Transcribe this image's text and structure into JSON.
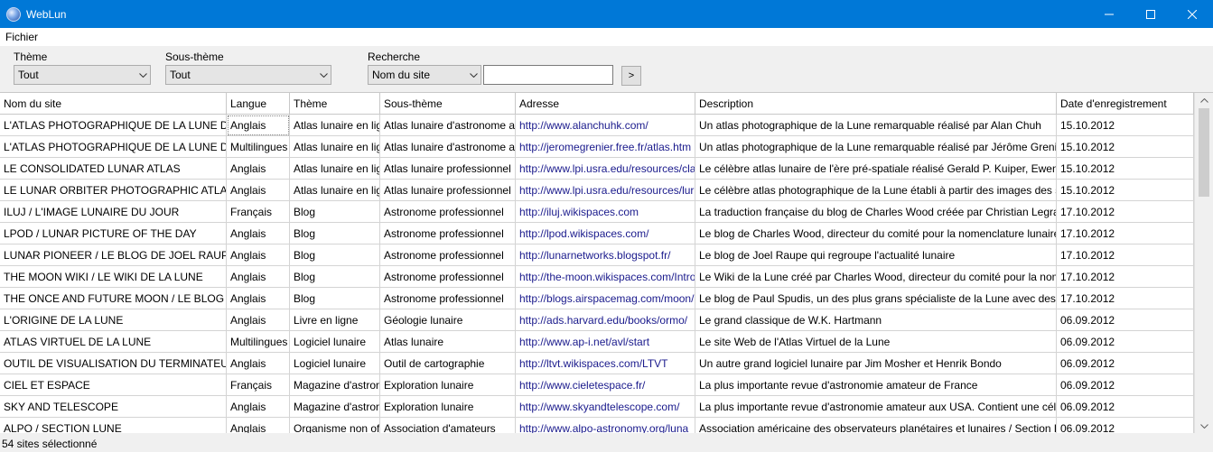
{
  "window": {
    "title": "WebLun"
  },
  "menu": {
    "file": "Fichier"
  },
  "filters": {
    "theme_label": "Thème",
    "theme_value": "Tout",
    "subtheme_label": "Sous-thème",
    "subtheme_value": "Tout",
    "search_label": "Recherche",
    "search_field_value": "Nom du site",
    "search_text": "",
    "go_label": ">"
  },
  "table": {
    "columns": [
      "Nom du site",
      "Langue",
      "Thème",
      "Sous-thème",
      "Adresse",
      "Description",
      "Date d'enregistrement"
    ],
    "rows": [
      [
        "L'ATLAS PHOTOGRAPHIQUE DE LA LUNE DE AL",
        "Anglais",
        "Atlas lunaire en lig",
        "Atlas lunaire d'astronome a",
        "http://www.alanchuhk.com/",
        "Un atlas photographique de la Lune remarquable réalisé par Alan Chuh",
        "15.10.2012"
      ],
      [
        "L'ATLAS PHOTOGRAPHIQUE DE LA LUNE DE JE",
        "Multilingues",
        "Atlas lunaire en lig",
        "Atlas lunaire d'astronome a",
        "http://jeromegrenier.free.fr/atlas.htm",
        "Un atlas photographique de la Lune remarquable réalisé par Jérôme Grenier",
        "15.10.2012"
      ],
      [
        "LE CONSOLIDATED LUNAR ATLAS",
        "Anglais",
        "Atlas lunaire en lig",
        "Atlas lunaire professionnel",
        "http://www.lpi.usra.edu/resources/cla",
        "Le célèbre atlas lunaire de l'ère pré-spatiale réalisé Gerald P. Kuiper, Ewen A",
        "15.10.2012"
      ],
      [
        "LE LUNAR ORBITER PHOTOGRAPHIC ATLAS OF",
        "Anglais",
        "Atlas lunaire en lig",
        "Atlas lunaire professionnel",
        "http://www.lpi.usra.edu/resources/lur",
        "Le célèbre atlas photographique de la Lune établi à partir des images des sc",
        "15.10.2012"
      ],
      [
        "ILUJ / L'IMAGE LUNAIRE DU JOUR",
        "Français",
        "Blog",
        "Astronome professionnel",
        "http://iluj.wikispaces.com",
        "La traduction française du blog de Charles Wood créée par Christian Legran",
        "17.10.2012"
      ],
      [
        "LPOD / LUNAR PICTURE OF THE DAY",
        "Anglais",
        "Blog",
        "Astronome professionnel",
        "http://lpod.wikispaces.com/",
        "Le blog de Charles Wood, directeur du comité pour la nomenclature lunaire",
        "17.10.2012"
      ],
      [
        "LUNAR PIONEER / LE BLOG DE JOEL RAUPE",
        "Anglais",
        "Blog",
        "Astronome professionnel",
        "http://lunarnetworks.blogspot.fr/",
        "Le blog de Joel Raupe qui regroupe l'actualité lunaire",
        "17.10.2012"
      ],
      [
        "THE MOON WIKI / LE WIKI DE LA LUNE",
        "Anglais",
        "Blog",
        "Astronome professionnel",
        "http://the-moon.wikispaces.com/Intro",
        "Le Wiki de la Lune créé par Charles Wood, directeur du comité pour la nom",
        "17.10.2012"
      ],
      [
        "THE ONCE AND FUTURE MOON / LE BLOG DE",
        "Anglais",
        "Blog",
        "Astronome professionnel",
        "http://blogs.airspacemag.com/moon/",
        "Le blog de Paul Spudis, un des plus grans spécialiste de la Lune avec des pr",
        "17.10.2012"
      ],
      [
        "L'ORIGINE DE LA LUNE",
        "Anglais",
        "Livre en ligne",
        "Géologie lunaire",
        "http://ads.harvard.edu/books/ormo/",
        "Le grand classique de W.K. Hartmann",
        "06.09.2012"
      ],
      [
        "ATLAS VIRTUEL DE LA LUNE",
        "Multilingues",
        "Logiciel lunaire",
        "Atlas lunaire",
        "http://www.ap-i.net/avl/start",
        "Le site Web de l'Atlas Virtuel de la Lune",
        "06.09.2012"
      ],
      [
        "OUTIL DE VISUALISATION DU TERMINATEUR LU",
        "Anglais",
        "Logiciel lunaire",
        "Outil de cartographie",
        "http://ltvt.wikispaces.com/LTVT",
        "Un autre grand logiciel lunaire par Jim Mosher et Henrik Bondo",
        "06.09.2012"
      ],
      [
        "CIEL ET ESPACE",
        "Français",
        "Magazine d'astron",
        "Exploration lunaire",
        "http://www.cieletespace.fr/",
        "La plus importante revue d'astronomie amateur de France",
        "06.09.2012"
      ],
      [
        "SKY AND TELESCOPE",
        "Anglais",
        "Magazine d'astron",
        "Exploration lunaire",
        "http://www.skyandtelescope.com/",
        "La plus importante revue d'astronomie amateur aux USA. Contient une célé",
        "06.09.2012"
      ],
      [
        "ALPO / SECTION LUNE",
        "Anglais",
        "Organisme non of",
        "Association d'amateurs",
        "http://www.alpo-astronomy.org/luna",
        "Association américaine des observateurs planétaires et lunaires / Section L",
        "06.09.2012"
      ]
    ]
  },
  "status": {
    "text": "54 sites sélectionné"
  }
}
